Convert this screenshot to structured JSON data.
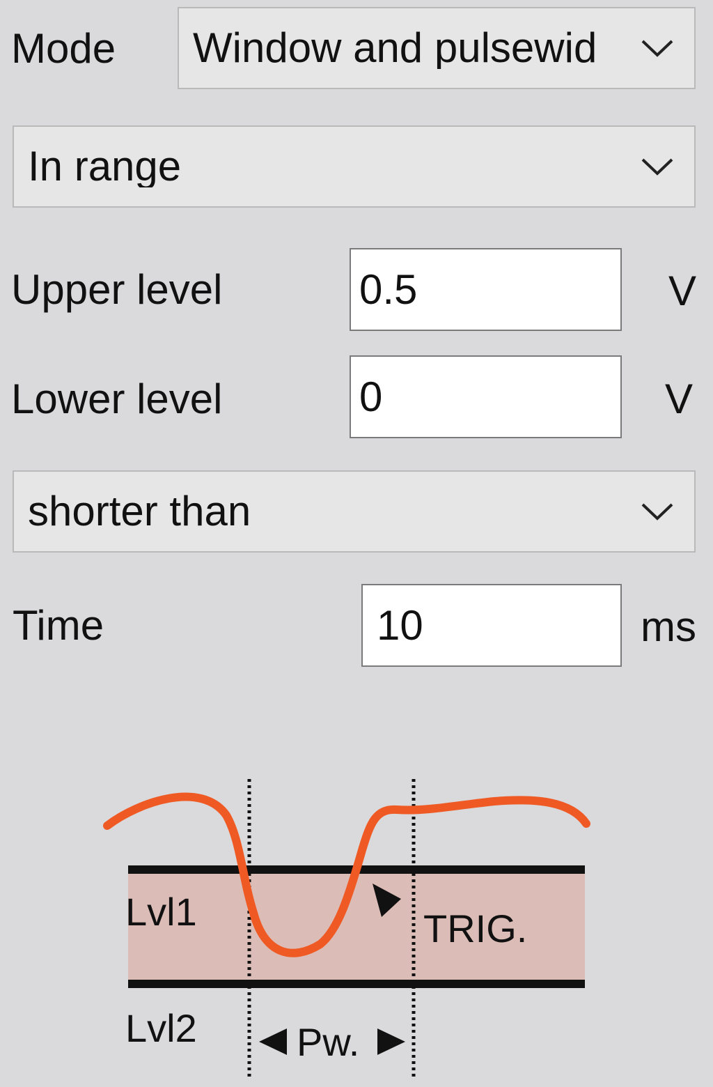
{
  "mode": {
    "label": "Mode",
    "selected": "Window and pulsewid"
  },
  "range": {
    "selected": "In range"
  },
  "upper_level": {
    "label": "Upper level",
    "value": "0.5",
    "unit": "V"
  },
  "lower_level": {
    "label": "Lower level",
    "value": "0",
    "unit": "V"
  },
  "duration": {
    "selected": "shorter than"
  },
  "time": {
    "label": "Time",
    "value": "10",
    "unit": "ms"
  },
  "diagram": {
    "level1_label": "Lvl1",
    "level2_label": "Lvl2",
    "trigger_label": "TRIG.",
    "pulsewidth_label": "Pw.",
    "signal_color": "#ef5a24",
    "band_color": "#dcbcb7"
  },
  "icons": {
    "dropdown": "chevron-down-icon",
    "trigger_arrow": "triangle-right-icon"
  }
}
